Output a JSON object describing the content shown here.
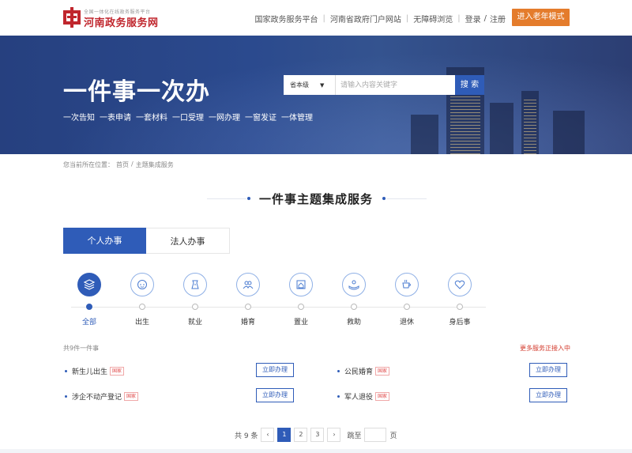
{
  "header": {
    "logo_sub": "全国一体化在线政务服务平台",
    "logo_title": "河南政务服务网",
    "nav": [
      "国家政务服务平台",
      "河南省政府门户网站",
      "无障碍浏览"
    ],
    "login": "登录",
    "register": "注册",
    "elder_mode": "进入老年模式"
  },
  "banner": {
    "title": "一件事一次办",
    "tags": [
      "一次告知",
      "一表申请",
      "一套材料",
      "一口受理",
      "一网办理",
      "一窗发证",
      "一体管理"
    ],
    "search": {
      "level": "省本级",
      "placeholder": "请输入内容关键字",
      "button": "搜 索"
    }
  },
  "breadcrumb": {
    "prefix": "您当前所在位置：",
    "home": "首页",
    "sep": "/",
    "current": "主题集成服务"
  },
  "section_title": "一件事主题集成服务",
  "tabs": [
    {
      "label": "个人办事",
      "active": true
    },
    {
      "label": "法人办事",
      "active": false
    }
  ],
  "categories": [
    {
      "label": "全部",
      "icon": "stack-icon",
      "active": true
    },
    {
      "label": "出生",
      "icon": "baby-icon",
      "active": false
    },
    {
      "label": "就业",
      "icon": "briefcase-icon",
      "active": false
    },
    {
      "label": "婚育",
      "icon": "couple-icon",
      "active": false
    },
    {
      "label": "置业",
      "icon": "house-icon",
      "active": false
    },
    {
      "label": "救助",
      "icon": "helping-hand-icon",
      "active": false
    },
    {
      "label": "退休",
      "icon": "tea-cup-icon",
      "active": false
    },
    {
      "label": "身后事",
      "icon": "heart-icon",
      "active": false
    }
  ],
  "results": {
    "count_text": "共9件一件事",
    "more_text": "更多服务正接入中",
    "items": [
      {
        "title": "新生儿出生",
        "badge": "国家",
        "action": "立即办理"
      },
      {
        "title": "公民婚育",
        "badge": "国家",
        "action": "立即办理"
      },
      {
        "title": "涉企不动产登记",
        "badge": "国家",
        "action": "立即办理"
      },
      {
        "title": "军人退役",
        "badge": "国家",
        "action": "立即办理"
      }
    ]
  },
  "pagination": {
    "total_text": "共 9 条",
    "prev": "‹",
    "next": "›",
    "pages": [
      "1",
      "2",
      "3"
    ],
    "current": "1",
    "jump_label": "跳至",
    "page_label": "页"
  },
  "colors": {
    "primary": "#2f5cb8",
    "brand_red": "#c0262d",
    "elder_orange": "#e47c2c",
    "badge_red": "#e04848"
  }
}
